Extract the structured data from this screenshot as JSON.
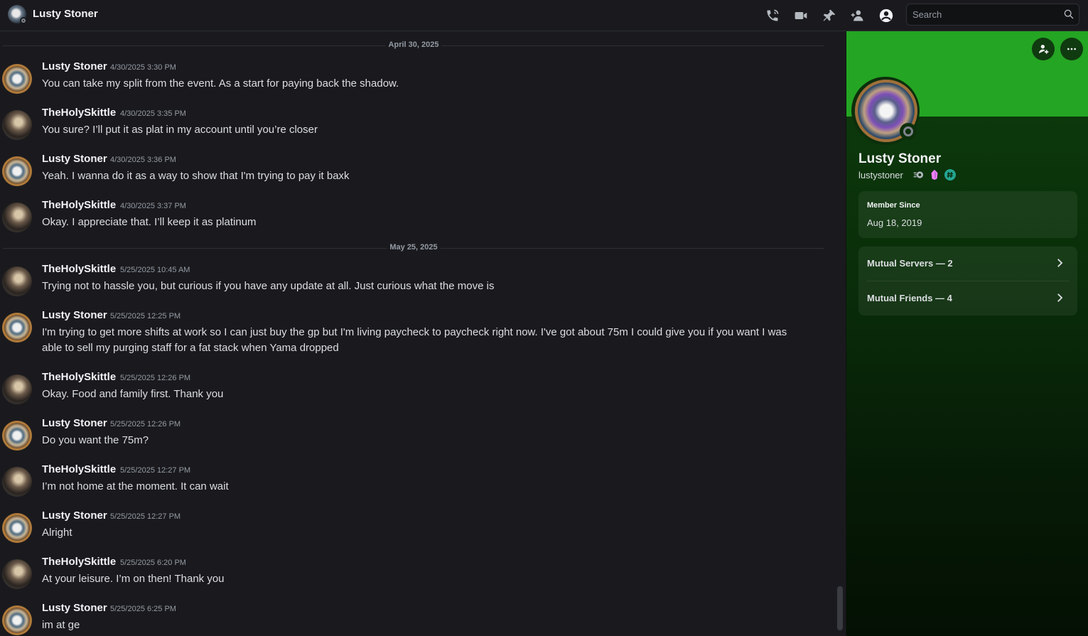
{
  "header": {
    "title": "Lusty Stoner",
    "search_placeholder": "Search",
    "icons": [
      "phone-call-icon",
      "video-call-icon",
      "pin-icon",
      "add-friends-icon",
      "user-profile-icon",
      "search-icon"
    ]
  },
  "chat": {
    "dividers": [
      "April 30, 2025",
      "May 25, 2025"
    ],
    "messages": [
      {
        "author": "Lusty Stoner",
        "time": "4/30/2025 3:30 PM",
        "text": "You can take my split from the event. As a start for paying back the shadow."
      },
      {
        "author": "TheHolySkittle",
        "time": "4/30/2025 3:35 PM",
        "text": "You sure? I’ll put it as plat in my account until you’re closer"
      },
      {
        "author": "Lusty Stoner",
        "time": "4/30/2025 3:36 PM",
        "text": "Yeah. I wanna do it as a way to show that I'm trying to pay it baxk"
      },
      {
        "author": "TheHolySkittle",
        "time": "4/30/2025 3:37 PM",
        "text": "Okay. I appreciate that. I’ll keep it as platinum"
      },
      {
        "author": "TheHolySkittle",
        "time": "5/25/2025 10:45 AM",
        "text": "Trying not to hassle you, but curious if you have any update at all. Just curious what the move is"
      },
      {
        "author": "Lusty Stoner",
        "time": "5/25/2025 12:25 PM",
        "text": "I'm trying to get more shifts at work so I can just buy the gp but I'm living paycheck to paycheck right now. I've got about 75m I could give you if you want I was able to sell my purging staff for a fat stack when Yama dropped"
      },
      {
        "author": "TheHolySkittle",
        "time": "5/25/2025 12:26 PM",
        "text": "Okay. Food and family first. Thank you"
      },
      {
        "author": "Lusty Stoner",
        "time": "5/25/2025 12:26 PM",
        "text": "Do you want the 75m?"
      },
      {
        "author": "TheHolySkittle",
        "time": "5/25/2025 12:27 PM",
        "text": "I’m not home at the moment. It can wait"
      },
      {
        "author": "Lusty Stoner",
        "time": "5/25/2025 12:27 PM",
        "text": "Alright"
      },
      {
        "author": "TheHolySkittle",
        "time": "5/25/2025 6:20 PM",
        "text": "At your leisure. I’m on then! Thank you"
      },
      {
        "author": "Lusty Stoner",
        "time": "5/25/2025 6:25 PM",
        "text": "im at ge"
      }
    ]
  },
  "profile": {
    "display_name": "Lusty Stoner",
    "username": "lustystoner",
    "member_since_label": "Member Since",
    "member_since_value": "Aug 18, 2019",
    "mutual_servers": "Mutual Servers — 2",
    "mutual_friends": "Mutual Friends — 4",
    "banner_color": "#24a523"
  }
}
